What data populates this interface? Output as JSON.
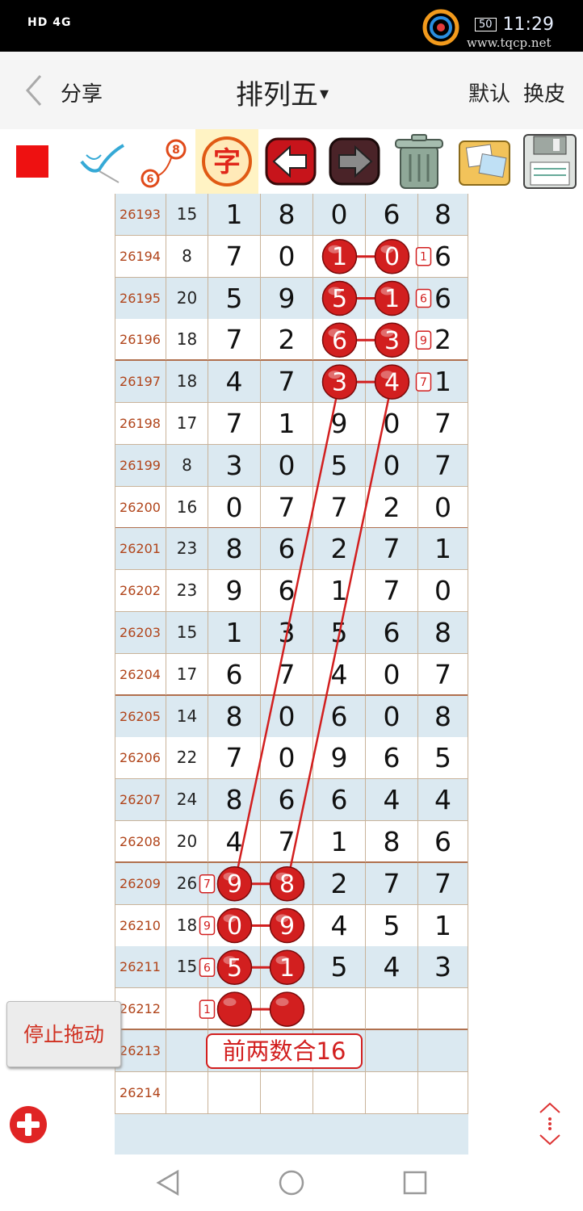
{
  "status_bar": {
    "network": "HD 4G",
    "battery": "50",
    "time": "11:29",
    "watermark": "www.tqcp.net"
  },
  "header": {
    "back_icon": "chevron-left-icon",
    "share_label": "分享",
    "title": "排列五",
    "title_caret": "▾",
    "default_label": "默认",
    "skin_label": "换皮"
  },
  "toolbar": {
    "icons": [
      "red-square-icon",
      "pen-check-icon",
      "dots-connect-icon",
      "char-zi-icon",
      "back-arrow-icon",
      "forward-arrow-icon",
      "trash-can-icon",
      "photo-album-icon",
      "save-disk-icon"
    ],
    "zi_char": "字"
  },
  "colors": {
    "accent_red": "#d21f1f",
    "row_blue": "#dbe9f1",
    "period_text": "#b0441a"
  },
  "rows": [
    {
      "period": "26193",
      "sum": "15",
      "digits": [
        "1",
        "8",
        "0",
        "6",
        "8"
      ]
    },
    {
      "period": "26194",
      "sum": "8",
      "digits": [
        "7",
        "0",
        "1",
        "0",
        "6"
      ]
    },
    {
      "period": "26195",
      "sum": "20",
      "digits": [
        "5",
        "9",
        "5",
        "1",
        "6"
      ]
    },
    {
      "period": "26196",
      "sum": "18",
      "digits": [
        "7",
        "2",
        "6",
        "3",
        "2"
      ]
    },
    {
      "period": "26197",
      "sum": "18",
      "digits": [
        "4",
        "7",
        "3",
        "4",
        "1"
      ]
    },
    {
      "period": "26198",
      "sum": "17",
      "digits": [
        "7",
        "1",
        "9",
        "0",
        "7"
      ]
    },
    {
      "period": "26199",
      "sum": "8",
      "digits": [
        "3",
        "0",
        "5",
        "0",
        "7"
      ]
    },
    {
      "period": "26200",
      "sum": "16",
      "digits": [
        "0",
        "7",
        "7",
        "2",
        "0"
      ]
    },
    {
      "period": "26201",
      "sum": "23",
      "digits": [
        "8",
        "6",
        "2",
        "7",
        "1"
      ]
    },
    {
      "period": "26202",
      "sum": "23",
      "digits": [
        "9",
        "6",
        "1",
        "7",
        "0"
      ]
    },
    {
      "period": "26203",
      "sum": "15",
      "digits": [
        "1",
        "3",
        "5",
        "6",
        "8"
      ]
    },
    {
      "period": "26204",
      "sum": "17",
      "digits": [
        "6",
        "7",
        "4",
        "0",
        "7"
      ]
    },
    {
      "period": "26205",
      "sum": "14",
      "digits": [
        "8",
        "0",
        "6",
        "0",
        "8"
      ]
    },
    {
      "period": "26206",
      "sum": "22",
      "digits": [
        "7",
        "0",
        "9",
        "6",
        "5"
      ]
    },
    {
      "period": "26207",
      "sum": "24",
      "digits": [
        "8",
        "6",
        "6",
        "4",
        "4"
      ]
    },
    {
      "period": "26208",
      "sum": "20",
      "digits": [
        "4",
        "7",
        "1",
        "8",
        "6"
      ]
    },
    {
      "period": "26209",
      "sum": "26",
      "digits": [
        "9",
        "8",
        "2",
        "7",
        "7"
      ]
    },
    {
      "period": "26210",
      "sum": "18",
      "digits": [
        "0",
        "9",
        "4",
        "5",
        "1"
      ]
    },
    {
      "period": "26211",
      "sum": "15",
      "digits": [
        "5",
        "1",
        "5",
        "4",
        "3"
      ]
    },
    {
      "period": "26212",
      "sum": "",
      "digits": [
        "",
        "",
        "",
        "",
        ""
      ]
    },
    {
      "period": "26213",
      "sum": "",
      "digits": [
        "",
        "",
        "",
        "",
        ""
      ]
    },
    {
      "period": "26214",
      "sum": "",
      "digits": [
        "",
        "",
        "",
        "",
        ""
      ]
    }
  ],
  "highlights": {
    "upper_pairs": [
      {
        "row": 1,
        "cols": [
          2,
          3
        ],
        "values": [
          "1",
          "0"
        ],
        "pair_sum": "1"
      },
      {
        "row": 2,
        "cols": [
          2,
          3
        ],
        "values": [
          "5",
          "1"
        ],
        "pair_sum": "6"
      },
      {
        "row": 3,
        "cols": [
          2,
          3
        ],
        "values": [
          "6",
          "3"
        ],
        "pair_sum": "9"
      },
      {
        "row": 4,
        "cols": [
          2,
          3
        ],
        "values": [
          "3",
          "4"
        ],
        "pair_sum": "7"
      }
    ],
    "lower_pairs": [
      {
        "row": 16,
        "cols": [
          0,
          1
        ],
        "values": [
          "9",
          "8"
        ],
        "pair_sum": "7"
      },
      {
        "row": 17,
        "cols": [
          0,
          1
        ],
        "values": [
          "0",
          "9"
        ],
        "pair_sum": "9"
      },
      {
        "row": 18,
        "cols": [
          0,
          1
        ],
        "values": [
          "5",
          "1"
        ],
        "pair_sum": "6"
      },
      {
        "row": 19,
        "cols": [
          0,
          1
        ],
        "values": [
          "",
          ""
        ],
        "pair_sum": "1"
      }
    ]
  },
  "annotation": "前两数合16",
  "stop_drag_label": "停止拖动",
  "buttons": {
    "add_icon": "plus-circle-icon",
    "scroll_icon": "up-down-arrows-icon"
  },
  "nav": {
    "back_icon": "nav-back-icon",
    "home_icon": "nav-home-icon",
    "recent_icon": "nav-recent-icon"
  }
}
